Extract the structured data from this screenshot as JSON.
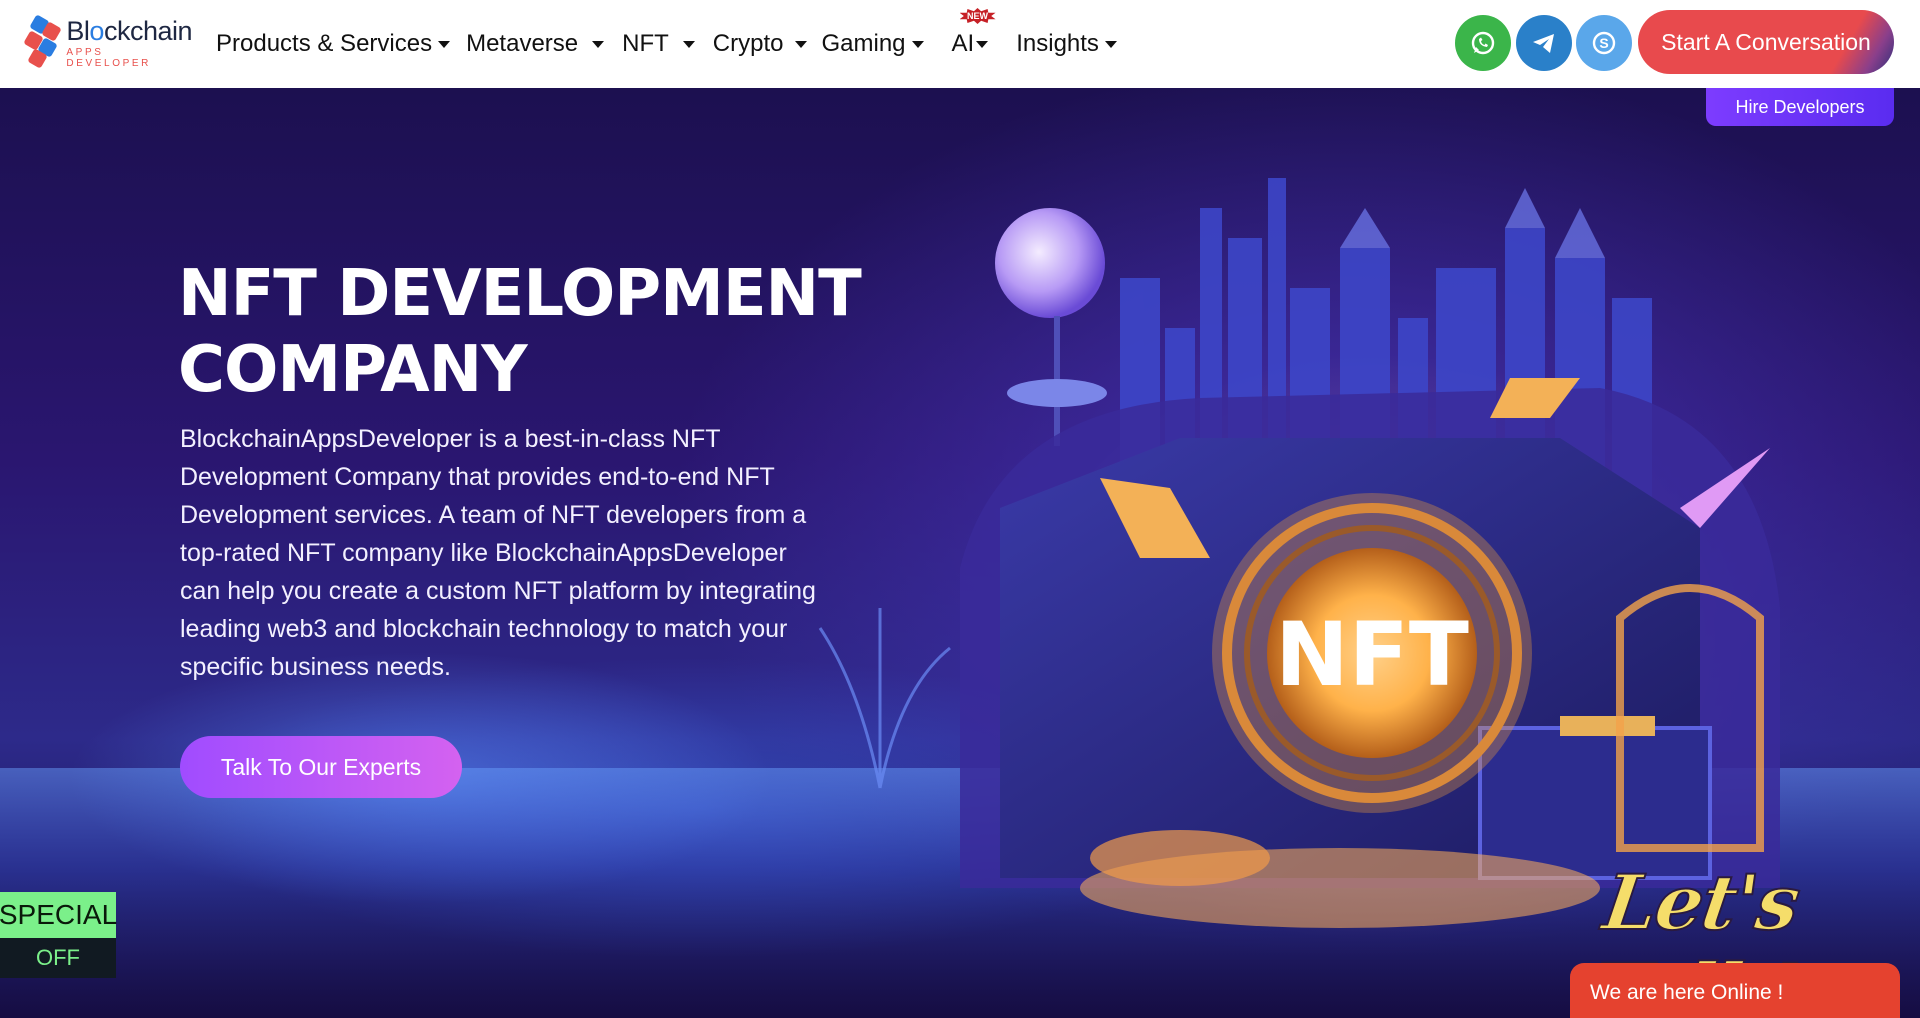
{
  "logo": {
    "name_part1": "Bl",
    "name_part2": "ckchain",
    "tagline": "APPS DEVELOPER"
  },
  "nav": {
    "items": [
      {
        "label": "Products & Services",
        "has_dropdown": true
      },
      {
        "label": "Metaverse",
        "has_dropdown": true
      },
      {
        "label": "NFT",
        "has_dropdown": true
      },
      {
        "label": "Crypto",
        "has_dropdown": true
      },
      {
        "label": "Gaming",
        "has_dropdown": true
      },
      {
        "label": "AI",
        "has_dropdown": true,
        "badge": "NEW"
      },
      {
        "label": "Insights",
        "has_dropdown": true
      }
    ]
  },
  "social": {
    "whatsapp_icon": "whatsapp-icon",
    "telegram_icon": "telegram-icon",
    "skype_icon": "skype-icon",
    "whatsapp_color": "#3bb54a",
    "telegram_color": "#2a80c9",
    "skype_color": "#5aa7ea"
  },
  "header_cta": "Start A Conversation",
  "hire_developers": "Hire Developers",
  "hero": {
    "title_line1": "NFT DEVELOPMENT",
    "title_line2": "COMPANY",
    "description": "BlockchainAppsDeveloper is a best-in-class NFT Development Company that provides end-to-end NFT Development services. A team of NFT developers from a top-rated NFT company like BlockchainAppsDeveloper can help you create a custom NFT platform by integrating leading web3 and blockchain technology to match your specific business needs.",
    "cta": "Talk To Our Experts",
    "art_coin_text": "NFT"
  },
  "special_offer": {
    "top": "SPECIAL",
    "bottom": "OFF"
  },
  "chat": {
    "lets_talk": "Let's Talk!",
    "online": "We are here Online !"
  },
  "colors": {
    "accent_red": "#e84a4d",
    "hero_purple": "#2a1670",
    "button_purple": "#a04cff"
  }
}
